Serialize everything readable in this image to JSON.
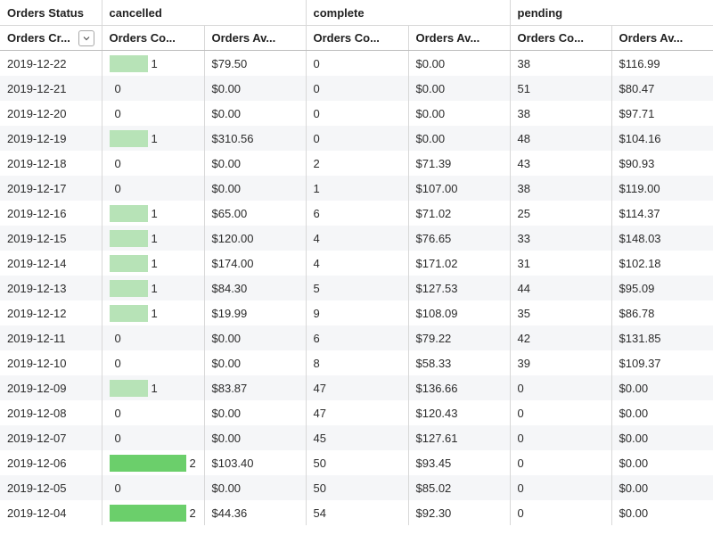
{
  "pivot": {
    "dimension_label": "Orders Status",
    "groups": [
      "cancelled",
      "complete",
      "pending"
    ]
  },
  "columns": {
    "date": "Orders Cr...",
    "count": "Orders Co...",
    "avg": "Orders Av..."
  },
  "colors": {
    "bar_single": "#b7e3b7",
    "bar_double": "#6bcf6b",
    "row_stripe": "#f5f6f8",
    "grid": "#d8d8d8"
  },
  "rows": [
    {
      "date": "2019-12-22",
      "cancelled_count": "1",
      "cancelled_avg": "$79.50",
      "complete_count": "0",
      "complete_avg": "$0.00",
      "pending_count": "38",
      "pending_avg": "$116.99"
    },
    {
      "date": "2019-12-21",
      "cancelled_count": "0",
      "cancelled_avg": "$0.00",
      "complete_count": "0",
      "complete_avg": "$0.00",
      "pending_count": "51",
      "pending_avg": "$80.47"
    },
    {
      "date": "2019-12-20",
      "cancelled_count": "0",
      "cancelled_avg": "$0.00",
      "complete_count": "0",
      "complete_avg": "$0.00",
      "pending_count": "38",
      "pending_avg": "$97.71"
    },
    {
      "date": "2019-12-19",
      "cancelled_count": "1",
      "cancelled_avg": "$310.56",
      "complete_count": "0",
      "complete_avg": "$0.00",
      "pending_count": "48",
      "pending_avg": "$104.16"
    },
    {
      "date": "2019-12-18",
      "cancelled_count": "0",
      "cancelled_avg": "$0.00",
      "complete_count": "2",
      "complete_avg": "$71.39",
      "pending_count": "43",
      "pending_avg": "$90.93"
    },
    {
      "date": "2019-12-17",
      "cancelled_count": "0",
      "cancelled_avg": "$0.00",
      "complete_count": "1",
      "complete_avg": "$107.00",
      "pending_count": "38",
      "pending_avg": "$119.00"
    },
    {
      "date": "2019-12-16",
      "cancelled_count": "1",
      "cancelled_avg": "$65.00",
      "complete_count": "6",
      "complete_avg": "$71.02",
      "pending_count": "25",
      "pending_avg": "$114.37"
    },
    {
      "date": "2019-12-15",
      "cancelled_count": "1",
      "cancelled_avg": "$120.00",
      "complete_count": "4",
      "complete_avg": "$76.65",
      "pending_count": "33",
      "pending_avg": "$148.03"
    },
    {
      "date": "2019-12-14",
      "cancelled_count": "1",
      "cancelled_avg": "$174.00",
      "complete_count": "4",
      "complete_avg": "$171.02",
      "pending_count": "31",
      "pending_avg": "$102.18"
    },
    {
      "date": "2019-12-13",
      "cancelled_count": "1",
      "cancelled_avg": "$84.30",
      "complete_count": "5",
      "complete_avg": "$127.53",
      "pending_count": "44",
      "pending_avg": "$95.09"
    },
    {
      "date": "2019-12-12",
      "cancelled_count": "1",
      "cancelled_avg": "$19.99",
      "complete_count": "9",
      "complete_avg": "$108.09",
      "pending_count": "35",
      "pending_avg": "$86.78"
    },
    {
      "date": "2019-12-11",
      "cancelled_count": "0",
      "cancelled_avg": "$0.00",
      "complete_count": "6",
      "complete_avg": "$79.22",
      "pending_count": "42",
      "pending_avg": "$131.85"
    },
    {
      "date": "2019-12-10",
      "cancelled_count": "0",
      "cancelled_avg": "$0.00",
      "complete_count": "8",
      "complete_avg": "$58.33",
      "pending_count": "39",
      "pending_avg": "$109.37"
    },
    {
      "date": "2019-12-09",
      "cancelled_count": "1",
      "cancelled_avg": "$83.87",
      "complete_count": "47",
      "complete_avg": "$136.66",
      "pending_count": "0",
      "pending_avg": "$0.00"
    },
    {
      "date": "2019-12-08",
      "cancelled_count": "0",
      "cancelled_avg": "$0.00",
      "complete_count": "47",
      "complete_avg": "$120.43",
      "pending_count": "0",
      "pending_avg": "$0.00"
    },
    {
      "date": "2019-12-07",
      "cancelled_count": "0",
      "cancelled_avg": "$0.00",
      "complete_count": "45",
      "complete_avg": "$127.61",
      "pending_count": "0",
      "pending_avg": "$0.00"
    },
    {
      "date": "2019-12-06",
      "cancelled_count": "2",
      "cancelled_avg": "$103.40",
      "complete_count": "50",
      "complete_avg": "$93.45",
      "pending_count": "0",
      "pending_avg": "$0.00"
    },
    {
      "date": "2019-12-05",
      "cancelled_count": "0",
      "cancelled_avg": "$0.00",
      "complete_count": "50",
      "complete_avg": "$85.02",
      "pending_count": "0",
      "pending_avg": "$0.00"
    },
    {
      "date": "2019-12-04",
      "cancelled_count": "2",
      "cancelled_avg": "$44.36",
      "complete_count": "54",
      "complete_avg": "$92.30",
      "pending_count": "0",
      "pending_avg": "$0.00"
    }
  ]
}
